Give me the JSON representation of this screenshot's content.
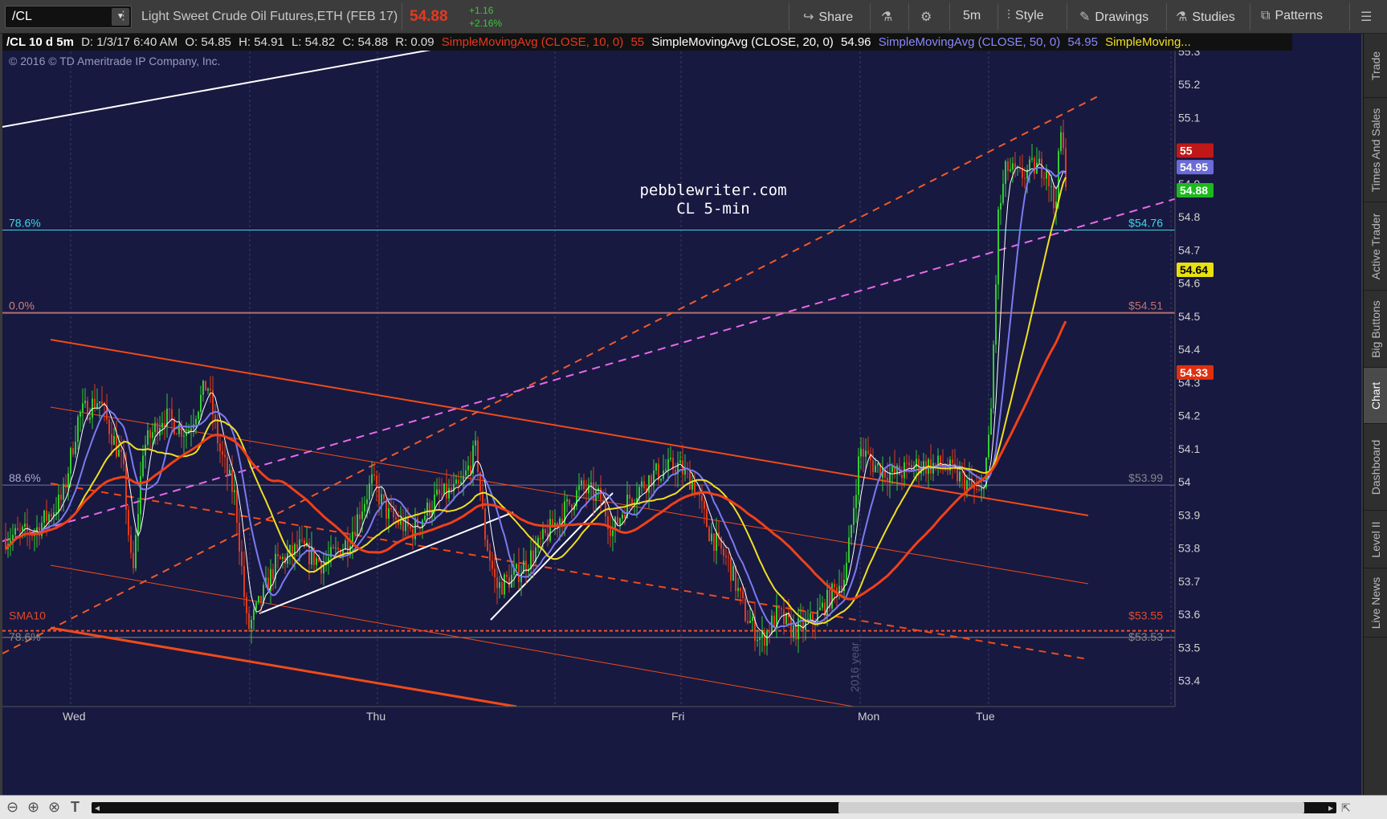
{
  "toolbar": {
    "symbol": "/CL",
    "description": "Light Sweet Crude Oil Futures,ETH (FEB 17)",
    "last_price": "54.88",
    "net_change": "+1.16",
    "net_change_pct": "+2.16%",
    "share_label": "Share",
    "timeframe_label": "5m",
    "style_label": "Style",
    "drawings_label": "Drawings",
    "studies_label": "Studies",
    "patterns_label": "Patterns"
  },
  "legend": {
    "header": "/CL 10 d 5m",
    "date": "D: 1/3/17 6:40 AM",
    "open": "O: 54.85",
    "high": "H: 54.91",
    "low": "L: 54.82",
    "close": "C: 54.88",
    "range": "R: 0.09",
    "sma10_label": "SimpleMovingAvg (CLOSE, 10, 0)",
    "sma10_value": "55",
    "sma20_label": "SimpleMovingAvg (CLOSE, 20, 0)",
    "sma20_value": "54.96",
    "sma50_label": "SimpleMovingAvg (CLOSE, 50, 0)",
    "sma50_value": "54.95",
    "sma_more_label": "SimpleMoving..."
  },
  "copyright": "© 2016 © TD Ameritrade IP Company, Inc.",
  "watermark": {
    "line1": "pebblewriter.com",
    "line2": "CL 5-min"
  },
  "fib_labels": {
    "f786": "78.6%",
    "f786_price": "$54.76",
    "f00": "0.0%",
    "f0_price": "$54.51",
    "f886": "88.6%",
    "f886_price": "$53.99",
    "sma10": "SMA10",
    "sma_price": "$53.55",
    "f786b": "78.6%",
    "f786b_price": "$53.53"
  },
  "vertical_note": "2016 year",
  "price_axis": {
    "ticks": [
      "55.3",
      "55.2",
      "55.1",
      "55",
      "54.9",
      "54.8",
      "54.7",
      "54.6",
      "54.5",
      "54.4",
      "54.3",
      "54.2",
      "54.1",
      "54",
      "53.9",
      "53.8",
      "53.7",
      "53.6",
      "53.5",
      "53.4"
    ],
    "badges": {
      "b55": "55",
      "b5495": "54.95",
      "b5488": "54.88",
      "b5464": "54.64",
      "b5433": "54.33"
    }
  },
  "time_axis": [
    "Wed",
    "Thu",
    "Fri",
    "Mon",
    "Tue"
  ],
  "side_tabs": [
    "Trade",
    "Times And Sales",
    "Active Trader",
    "Big Buttons",
    "Chart",
    "Dashboard",
    "Level II",
    "Live News"
  ],
  "colors": {
    "chart_bg": "#171940",
    "sma10": "#ffffff",
    "sma20": "#7b7bf0",
    "sma50": "#f0e020",
    "sma200": "#f0401a",
    "channel": "#f04a1a",
    "pink_trend": "#e86ae8",
    "fib_cyan": "#3cd8e8",
    "last_price": "#e8371f"
  },
  "chart_data": {
    "type": "candlestick",
    "symbol": "/CL",
    "interval": "5m",
    "range": "10 d",
    "ylim": [
      53.3,
      55.35
    ],
    "x_labels": [
      "Wed",
      "Thu",
      "Fri",
      "Mon",
      "Tue"
    ],
    "series": [
      {
        "name": "SimpleMovingAvg (CLOSE, 10, 0)",
        "last": 55.0
      },
      {
        "name": "SimpleMovingAvg (CLOSE, 20, 0)",
        "last": 54.96
      },
      {
        "name": "SimpleMovingAvg (CLOSE, 50, 0)",
        "last": 54.95
      }
    ],
    "levels": [
      {
        "label": "78.6%",
        "value": 54.76
      },
      {
        "label": "0.0%",
        "value": 54.51
      },
      {
        "label": "88.6%",
        "value": 53.99
      },
      {
        "label": "SMA10",
        "value": 53.55
      },
      {
        "label": "78.6%",
        "value": 53.53
      }
    ],
    "last": {
      "open": 54.85,
      "high": 54.91,
      "low": 54.82,
      "close": 54.88
    }
  }
}
